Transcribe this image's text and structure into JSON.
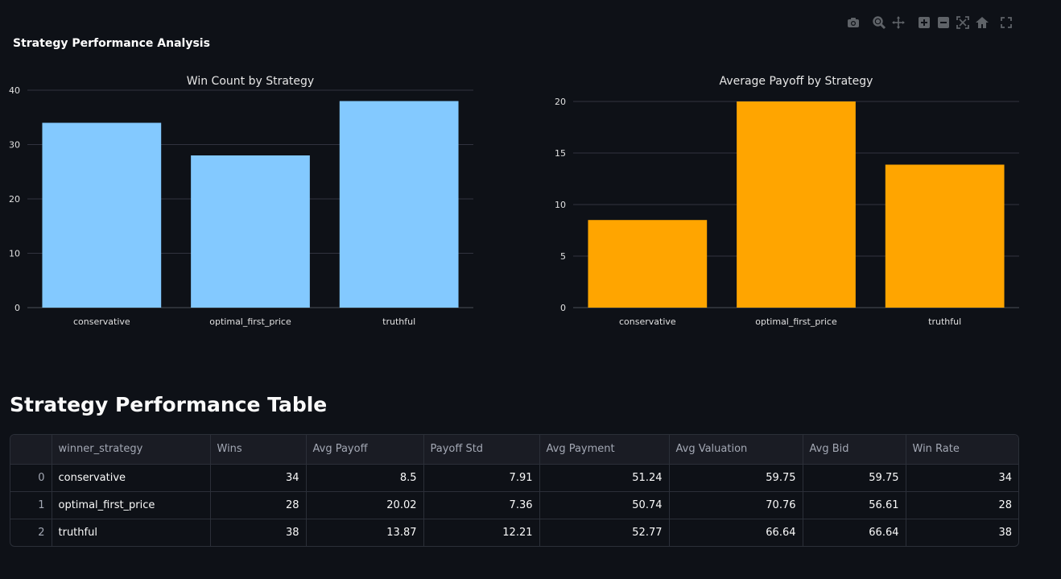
{
  "figure": {
    "title": "Strategy Performance Analysis"
  },
  "modebar": {
    "buttons": [
      {
        "name": "camera-icon",
        "label": "Download plot as a png"
      },
      {
        "name": "zoom-icon",
        "label": "Zoom"
      },
      {
        "name": "pan-icon",
        "label": "Pan"
      },
      {
        "name": "zoom-in-icon",
        "label": "Zoom in"
      },
      {
        "name": "zoom-out-icon",
        "label": "Zoom out"
      },
      {
        "name": "autoscale-icon",
        "label": "Autoscale"
      },
      {
        "name": "home-icon",
        "label": "Reset axes"
      },
      {
        "name": "fullscreen-icon",
        "label": "Fullscreen"
      }
    ],
    "icon_color": "#5f6368"
  },
  "chart_data": [
    {
      "type": "bar",
      "title": "Win Count by Strategy",
      "categories": [
        "conservative",
        "optimal_first_price",
        "truthful"
      ],
      "values": [
        34,
        28,
        38
      ],
      "ylim": [
        0,
        40
      ],
      "yticks": [
        0,
        10,
        20,
        30,
        40
      ],
      "grid": true,
      "color": "#83c9ff"
    },
    {
      "type": "bar",
      "title": "Average Payoff by Strategy",
      "categories": [
        "conservative",
        "optimal_first_price",
        "truthful"
      ],
      "values": [
        8.5,
        20.02,
        13.87
      ],
      "ylim": [
        0,
        20
      ],
      "yticks": [
        0,
        5,
        10,
        15,
        20
      ],
      "grid": true,
      "color": "#ffa500"
    }
  ],
  "table": {
    "title": "Strategy Performance Table",
    "columns": [
      "",
      "winner_strategy",
      "Wins",
      "Avg Payoff",
      "Payoff Std",
      "Avg Payment",
      "Avg Valuation",
      "Avg Bid",
      "Win Rate"
    ],
    "rows": [
      [
        "0",
        "conservative",
        "34",
        "8.5",
        "7.91",
        "51.24",
        "59.75",
        "59.75",
        "34"
      ],
      [
        "1",
        "optimal_first_price",
        "28",
        "20.02",
        "7.36",
        "50.74",
        "70.76",
        "56.61",
        "28"
      ],
      [
        "2",
        "truthful",
        "38",
        "13.87",
        "12.21",
        "52.77",
        "66.64",
        "66.64",
        "38"
      ]
    ]
  }
}
